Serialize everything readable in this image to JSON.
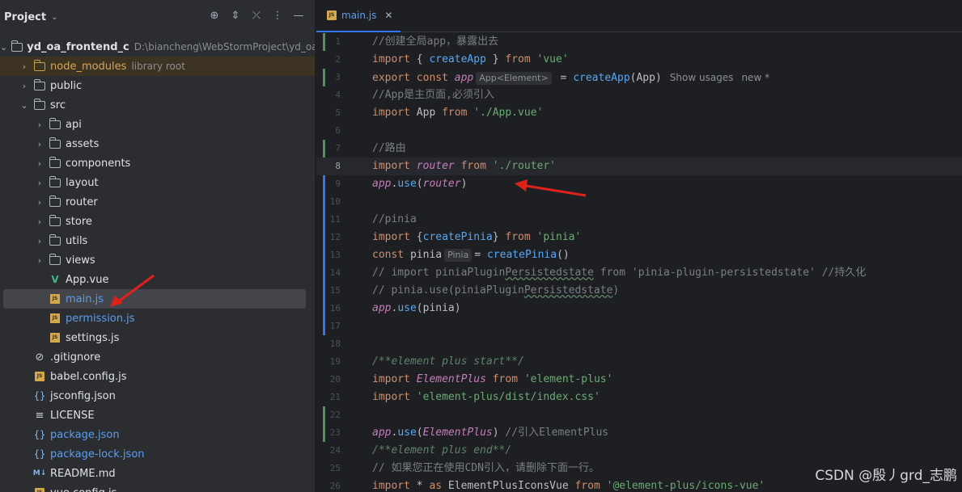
{
  "project_panel": {
    "title": "Project",
    "tree": [
      {
        "label": "yd_oa_frontend_c",
        "hint": "D:\\biancheng\\WebStormProject\\yd_oa_fr",
        "type": "root",
        "depth": 0,
        "expanded": true
      },
      {
        "label": "node_modules",
        "hint": "library root",
        "type": "folder-lib",
        "depth": 1,
        "expanded": false
      },
      {
        "label": "public",
        "type": "folder",
        "depth": 1,
        "expanded": false
      },
      {
        "label": "src",
        "type": "folder",
        "depth": 1,
        "expanded": true
      },
      {
        "label": "api",
        "type": "folder",
        "depth": 2
      },
      {
        "label": "assets",
        "type": "folder",
        "depth": 2
      },
      {
        "label": "components",
        "type": "folder",
        "depth": 2
      },
      {
        "label": "layout",
        "type": "folder",
        "depth": 2
      },
      {
        "label": "router",
        "type": "folder",
        "depth": 2
      },
      {
        "label": "store",
        "type": "folder",
        "depth": 2
      },
      {
        "label": "utils",
        "type": "folder",
        "depth": 2
      },
      {
        "label": "views",
        "type": "folder",
        "depth": 2
      },
      {
        "label": "App.vue",
        "type": "vue",
        "depth": 2
      },
      {
        "label": "main.js",
        "type": "js",
        "depth": 2,
        "selected": true
      },
      {
        "label": "permission.js",
        "type": "js",
        "depth": 2
      },
      {
        "label": "settings.js",
        "type": "js",
        "depth": 2
      },
      {
        "label": ".gitignore",
        "type": "git",
        "depth": 1
      },
      {
        "label": "babel.config.js",
        "type": "js",
        "depth": 1
      },
      {
        "label": "jsconfig.json",
        "type": "json",
        "depth": 1
      },
      {
        "label": "LICENSE",
        "type": "license",
        "depth": 1
      },
      {
        "label": "package.json",
        "type": "json",
        "depth": 1
      },
      {
        "label": "package-lock.json",
        "type": "json",
        "depth": 1
      },
      {
        "label": "README.md",
        "type": "md",
        "depth": 1
      },
      {
        "label": "vue.config.js",
        "type": "js",
        "depth": 1
      }
    ]
  },
  "editor": {
    "tab": {
      "label": "main.js",
      "close": "✕",
      "icon": "JS"
    },
    "current_line": 8,
    "inlay_hints": {
      "app_type": "App<Element>",
      "show_usages": "Show usages",
      "new_marker": "new *",
      "pinia_type": "Pinia"
    },
    "line_numbers": [
      "1",
      "2",
      "3",
      "4",
      "5",
      "6",
      "7",
      "8",
      "9",
      "10",
      "11",
      "12",
      "13",
      "14",
      "15",
      "16",
      "17",
      "18",
      "19",
      "20",
      "21",
      "22",
      "23",
      "24",
      "25",
      "26"
    ],
    "lines": [
      "//创建全局app，暴露出去",
      "import { createApp } from 'vue'",
      "export const app = createApp(App)",
      "//App是主页面,必须引入",
      "import App from './App.vue'",
      "",
      "//路由",
      "import router from './router'",
      "app.use(router)",
      "",
      "//pinia",
      "import {createPinia} from 'pinia'",
      "const pinia = createPinia()",
      "// import piniaPluginPersistedstate from 'pinia-plugin-persistedstate' //持久化",
      "// pinia.use(piniaPluginPersistedstate)",
      "app.use(pinia)",
      "",
      "",
      "/**element plus start**/",
      "import ElementPlus from 'element-plus'",
      "import 'element-plus/dist/index.css'",
      "",
      "app.use(ElementPlus) //引入ElementPlus",
      "/**element plus end**/",
      "// 如果您正在使用CDN引入，请删除下面一行。",
      "import * as ElementPlusIconsVue from '@element-plus/icons-vue'"
    ]
  },
  "watermark": "CSDN @殷丿grd_志鹏",
  "colors": {
    "accent": "#3574f0",
    "arrow": "#e0201b",
    "selection": "#43454a"
  }
}
